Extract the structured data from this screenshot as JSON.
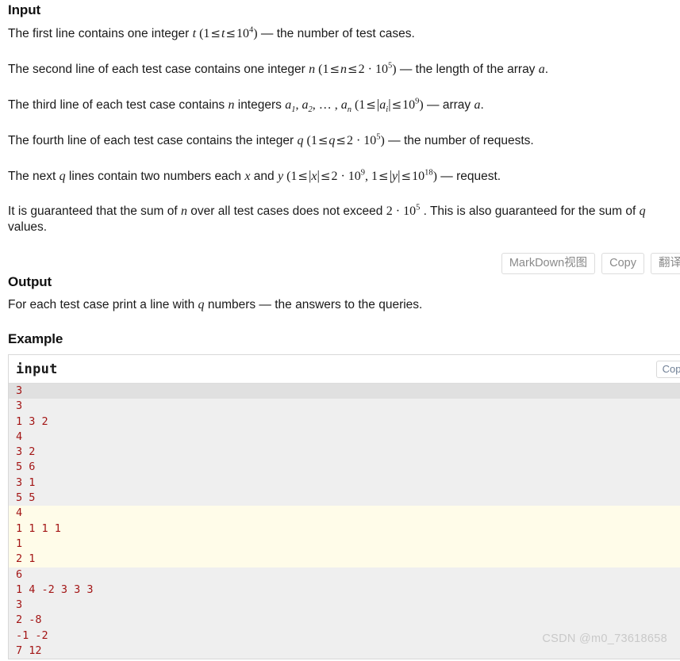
{
  "sections": {
    "input": {
      "heading": "Input",
      "paragraphs": [
        {
          "parts": [
            {
              "t": "text",
              "v": "The first line contains one integer "
            },
            {
              "t": "mi",
              "v": "t"
            },
            {
              "t": "text",
              "v": " ("
            },
            {
              "t": "mn",
              "v": "1"
            },
            {
              "t": "rel",
              "v": "≤"
            },
            {
              "t": "mi",
              "v": "t"
            },
            {
              "t": "rel",
              "v": "≤"
            },
            {
              "t": "pow",
              "base": "10",
              "exp": "4"
            },
            {
              "t": "text",
              "v": ") — the number of test cases."
            }
          ],
          "plain": "The first line contains one integer t (1 ≤ t ≤ 10^4) — the number of test cases."
        },
        {
          "plain": "The second line of each test case contains one integer n (1 ≤ n ≤ 2 · 10^5) — the length of the array a."
        },
        {
          "plain": "The third line of each test case contains n integers a_1, a_2, … , a_n (1 ≤ |a_i| ≤ 10^9) — array a."
        },
        {
          "plain": "The fourth line of each test case contains the integer q (1 ≤ q ≤ 2 · 10^5) — the number of requests."
        },
        {
          "plain": "The next q lines contain two numbers each x and y (1 ≤ |x| ≤ 2 · 10^9, 1 ≤ |y| ≤ 10^18) — request."
        },
        {
          "plain": "It is guaranteed that the sum of n over all test cases does not exceed 2 · 10^5 . This is also guaranteed for the sum of q values."
        }
      ]
    },
    "output": {
      "heading": "Output",
      "paragraph": "For each test case print a line with q numbers — the answers to the queries."
    },
    "example": {
      "heading": "Example"
    }
  },
  "toolbar": {
    "markdown_view_label": "MarkDown视图",
    "copy_label": "Copy",
    "translate_label": "翻译"
  },
  "code_block": {
    "title": "input",
    "copy_label": "Copy",
    "lines": [
      {
        "text": "3",
        "bg": "hover"
      },
      {
        "text": "3",
        "bg": "plain"
      },
      {
        "text": "1 3 2",
        "bg": "plain"
      },
      {
        "text": "4",
        "bg": "plain"
      },
      {
        "text": "3 2",
        "bg": "plain"
      },
      {
        "text": "5 6",
        "bg": "plain"
      },
      {
        "text": "3 1",
        "bg": "plain"
      },
      {
        "text": "5 5",
        "bg": "plain"
      },
      {
        "text": "4",
        "bg": "yellow"
      },
      {
        "text": "1 1 1 1",
        "bg": "yellow"
      },
      {
        "text": "1",
        "bg": "yellow"
      },
      {
        "text": "2 1",
        "bg": "yellow"
      },
      {
        "text": "6",
        "bg": "plain"
      },
      {
        "text": "1 4 -2 3 3 3",
        "bg": "plain"
      },
      {
        "text": "3",
        "bg": "plain"
      },
      {
        "text": "2 -8",
        "bg": "plain"
      },
      {
        "text": "-1 -2",
        "bg": "plain"
      },
      {
        "text": "7 12",
        "bg": "plain"
      }
    ]
  },
  "watermark": {
    "text": "CSDN @m0_73618658"
  },
  "colors": {
    "code_text": "#a31515",
    "code_bg": "#efefef",
    "code_bg_hover": "#e0e0e0",
    "code_bg_highlight": "#fffce9",
    "watermark": "#c9c9c9",
    "button_border": "#dcdcdc",
    "button_text": "#8a8a8a"
  }
}
